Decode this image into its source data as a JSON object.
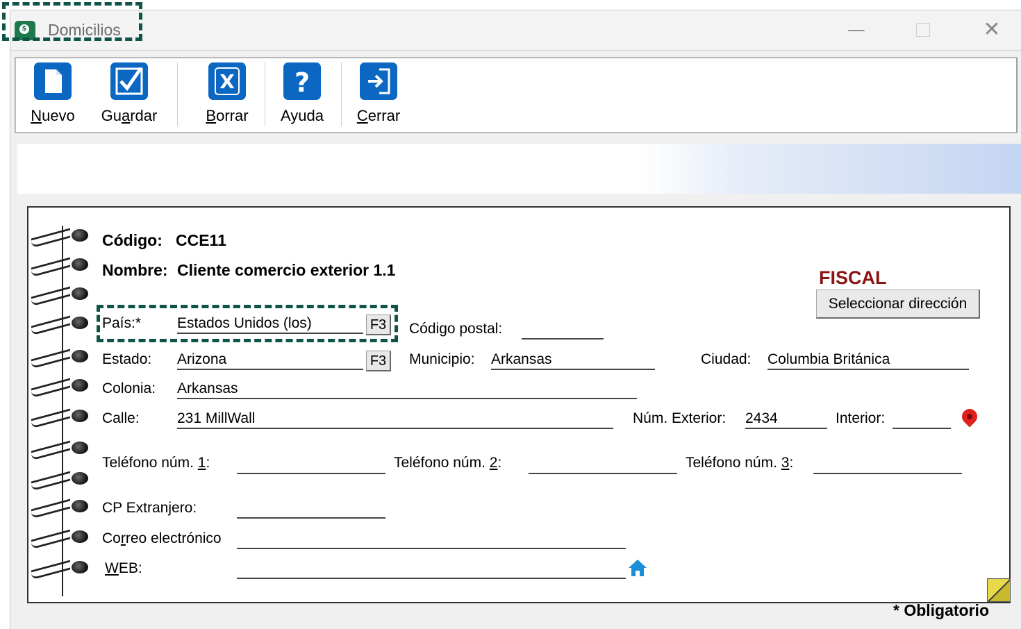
{
  "window": {
    "title": "Domicilios",
    "controls": {
      "minimize": "—",
      "close": "✕"
    }
  },
  "toolbar": {
    "new_label": "Nuevo",
    "save_label": "Guardar",
    "delete_label": "Borrar",
    "help_label": "Ayuda",
    "close_label": "Cerrar"
  },
  "form": {
    "codigo_label": "Código:",
    "codigo_value": "CCE11",
    "nombre_label": "Nombre:",
    "nombre_value": "Cliente comercio exterior 1.1",
    "fiscal": "FISCAL",
    "select_address_button": "Seleccionar dirección",
    "pais_label": "País:*",
    "pais_value": "Estados Unidos (los)",
    "f3_label": "F3",
    "codigo_postal_label": "Código postal:",
    "codigo_postal_value": "",
    "estado_label": "Estado:",
    "estado_value": "Arizona",
    "municipio_label": "Municipio:",
    "municipio_value": "Arkansas",
    "ciudad_label": "Ciudad:",
    "ciudad_value": "Columbia Británica",
    "colonia_label": "Colonia:",
    "colonia_value": "Arkansas",
    "calle_label": "Calle:",
    "calle_value": "231 MillWall",
    "num_exterior_label": "Núm. Exterior:",
    "num_exterior_value": "2434",
    "interior_label": "Interior:",
    "interior_value": "",
    "telefono1_label": "Teléfono núm. 1:",
    "telefono2_label": "Teléfono núm. 2:",
    "telefono3_label": "Teléfono núm. 3:",
    "cp_extranjero_label": "CP Extranjero:",
    "correo_label": "Correo electrónico",
    "web_label": "WEB:",
    "obligatorio": "* Obligatorio"
  },
  "icons": {
    "app": "app-icon",
    "nuevo": "new-document-icon",
    "guardar": "checkmark-icon",
    "borrar": "delete-x-icon",
    "ayuda": "question-icon",
    "cerrar": "exit-door-icon",
    "map": "map-pin-icon",
    "home": "home-icon"
  },
  "colors": {
    "toolbar_icon": "#0b67c2",
    "fiscal": "#8a1414",
    "highlight": "#0f5448",
    "pin": "#e0201a",
    "home": "#1a8fd8"
  }
}
